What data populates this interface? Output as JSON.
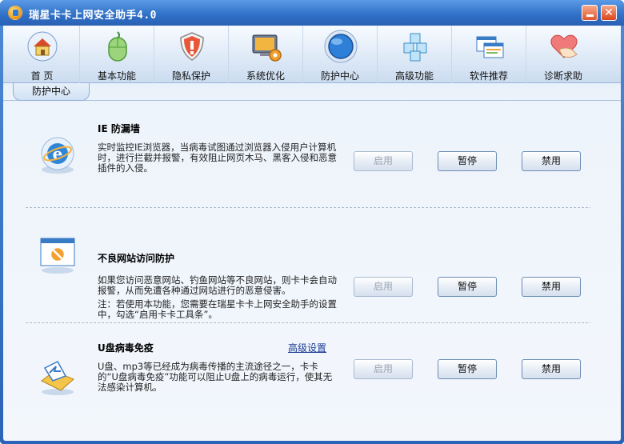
{
  "window": {
    "title": "瑞星卡卡上网安全助手4.0"
  },
  "toolbar": {
    "items": [
      {
        "label": "首 页",
        "icon": "home-icon"
      },
      {
        "label": "基本功能",
        "icon": "mouse-icon"
      },
      {
        "label": "隐私保护",
        "icon": "shield-icon"
      },
      {
        "label": "系统优化",
        "icon": "monitor-gear-icon"
      },
      {
        "label": "防护中心",
        "icon": "protection-globe-icon"
      },
      {
        "label": "高级功能",
        "icon": "cubes-icon"
      },
      {
        "label": "软件推荐",
        "icon": "windows-icon"
      },
      {
        "label": "诊断求助",
        "icon": "heart-hand-icon"
      }
    ],
    "active_index": 4
  },
  "tab": {
    "label": "防护中心"
  },
  "sections": [
    {
      "title": "IE 防漏墙",
      "desc": "实时监控IE浏览器，当病毒试图通过浏览器入侵用户计算机时，进行拦截并报警，有效阻止网页木马、黑客入侵和恶意插件的入侵。",
      "icon": "ie-browser-icon",
      "buttons": {
        "enable": "启用",
        "pause": "暂停",
        "disable": "禁用"
      }
    },
    {
      "title": "不良网站访问防护",
      "desc": "如果您访问恶意网站、钓鱼网站等不良网站，则卡卡会自动报警，从而免遭各种通过网站进行的恶意侵害。",
      "note": "注：若使用本功能，您需要在瑞星卡卡上网安全助手的设置中，勾选“启用卡卡工具条”。",
      "icon": "blocked-website-icon",
      "buttons": {
        "enable": "启用",
        "pause": "暂停",
        "disable": "禁用"
      }
    },
    {
      "title": "U盘病毒免疫",
      "link": "高级设置",
      "desc": "U盘、mp3等已经成为病毒传播的主流途径之一，卡卡的“U盘病毒免疫”功能可以阻止U盘上的病毒运行，使其无法感染计算机。",
      "icon": "usb-immunity-icon",
      "buttons": {
        "enable": "启用",
        "pause": "暂停",
        "disable": "禁用"
      }
    }
  ]
}
